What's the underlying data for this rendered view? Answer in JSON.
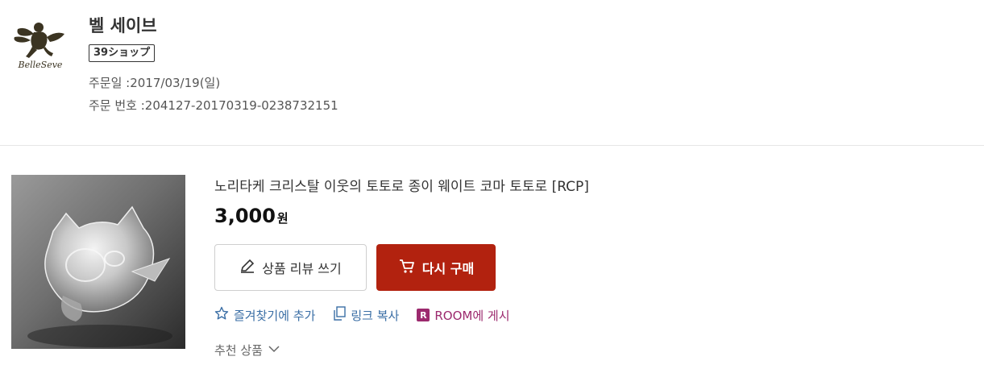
{
  "shop": {
    "name": "벨 세이브",
    "badge": "39ショップ",
    "logo_text": "BelleSeve",
    "order_date_label": "주문일 :",
    "order_date": "2017/03/19(일)",
    "order_number_label": "주문 번호 :",
    "order_number": "204127-20170319-0238732151"
  },
  "product": {
    "title": "노리타케 크리스탈 이웃의 토토로 종이 웨이트 코마 토토로 [RCP]",
    "price": "3,000",
    "price_unit": "원",
    "image_icon": "crystal-totoro-figurine"
  },
  "actions": {
    "review_label": "상품 리뷰 쓰기",
    "rebuy_label": "다시 구매",
    "favorite_label": "즐겨찾기에 추가",
    "copy_link_label": "링크 복사",
    "room_badge": "R",
    "room_label": "ROOM에 게시",
    "recommend_label": "추천 상품"
  },
  "icons": {
    "review": "pencil-icon",
    "rebuy": "cart-icon",
    "favorite": "star-icon",
    "copy": "copy-icon",
    "recommend": "chevron-down-icon"
  },
  "colors": {
    "rebuy_button": "#b2220f",
    "link_blue": "#3a6ea5",
    "room_purple": "#9c2a6e"
  }
}
